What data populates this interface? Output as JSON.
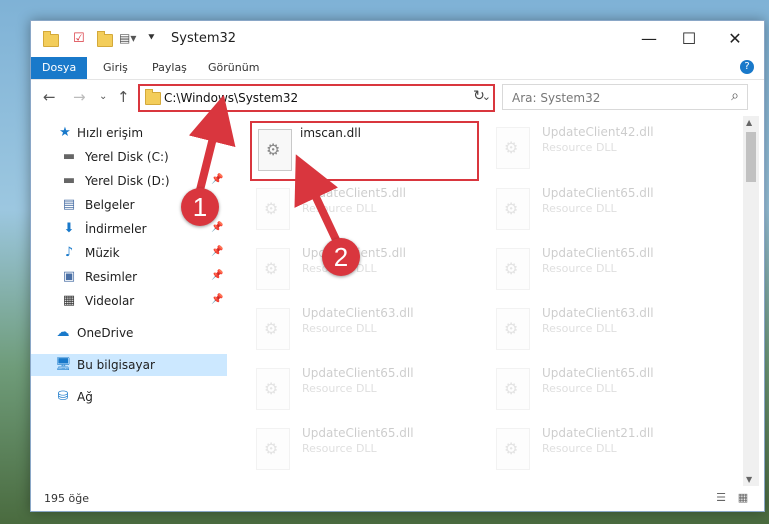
{
  "window": {
    "title": "System32",
    "controls": {
      "minimize": "—",
      "maximize": "☐",
      "close": "✕"
    }
  },
  "ribbon": {
    "tabs": [
      "Dosya",
      "Giriş",
      "Paylaş",
      "Görünüm"
    ],
    "help": "?"
  },
  "nav": {
    "address": "C:\\Windows\\System32",
    "search_placeholder": "Ara: System32"
  },
  "sidebar": {
    "items": [
      {
        "label": "Hızlı erişim",
        "icon": "star-icon"
      },
      {
        "label": "Yerel Disk (C:)",
        "icon": "drive-icon"
      },
      {
        "label": "Yerel Disk (D:)",
        "icon": "drive-icon"
      },
      {
        "label": "Belgeler",
        "icon": "documents-icon"
      },
      {
        "label": "İndirmeler",
        "icon": "download-icon"
      },
      {
        "label": "Müzik",
        "icon": "music-icon"
      },
      {
        "label": "Resimler",
        "icon": "pictures-icon"
      },
      {
        "label": "Videolar",
        "icon": "video-icon"
      },
      {
        "label": "OneDrive",
        "icon": "cloud-icon"
      },
      {
        "label": "Bu bilgisayar",
        "icon": "computer-icon"
      },
      {
        "label": "Ağ",
        "icon": "network-icon"
      }
    ]
  },
  "files": [
    {
      "name": "imscan.dll",
      "type": ""
    },
    {
      "name": "UpdateClient42.dll",
      "type": "Resource DLL"
    },
    {
      "name": "UpdateClient5.dll",
      "type": "Resource DLL"
    },
    {
      "name": "UpdateClient65.dll",
      "type": "Resource DLL"
    },
    {
      "name": "UpdateClient5.dll",
      "type": "Resource DLL"
    },
    {
      "name": "UpdateClient65.dll",
      "type": "Resource DLL"
    },
    {
      "name": "UpdateClient63.dll",
      "type": "Resource DLL"
    },
    {
      "name": "UpdateClient63.dll",
      "type": "Resource DLL"
    },
    {
      "name": "UpdateClient65.dll",
      "type": "Resource DLL"
    },
    {
      "name": "UpdateClient65.dll",
      "type": "Resource DLL"
    },
    {
      "name": "UpdateClient65.dll",
      "type": "Resource DLL"
    },
    {
      "name": "UpdateClient21.dll",
      "type": "Resource DLL"
    }
  ],
  "status": {
    "item_count": "195 öğe"
  },
  "annotations": {
    "step1": "1",
    "step2": "2"
  },
  "colors": {
    "accent": "#1979ca",
    "highlight": "#d9363e"
  }
}
